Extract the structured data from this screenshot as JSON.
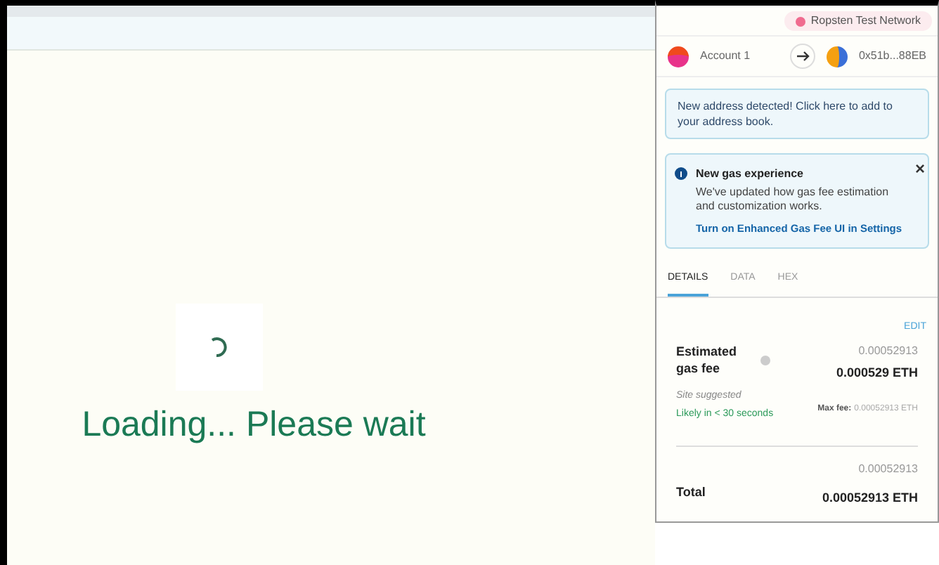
{
  "page": {
    "loading_text": "Loading... Please wait"
  },
  "wallet": {
    "network": "Ropsten Test Network",
    "from_account": "Account 1",
    "to_address": "0x51b...88EB",
    "address_notice": "New address detected! Click here to add to your address book.",
    "gas_notice": {
      "title": "New gas experience",
      "body": "We've updated how gas fee estimation and customization works.",
      "link": "Turn on Enhanced Gas Fee UI in Settings",
      "close": "×"
    },
    "tabs": [
      {
        "label": "DETAILS",
        "selected": true
      },
      {
        "label": "DATA",
        "selected": false
      },
      {
        "label": "HEX",
        "selected": false
      }
    ],
    "edit": "EDIT",
    "estimated_gas_fee": {
      "label": "Estimated gas fee",
      "amount": "0.00052913",
      "amount_eth": "0.000529 ETH",
      "site_suggested": "Site suggested",
      "timing": "Likely in < 30 seconds",
      "max_fee_label": "Max fee:",
      "max_fee_value": "0.00052913 ETH"
    },
    "total": {
      "label": "Total",
      "amount": "0.00052913",
      "amount_eth": "0.00052913 ETH"
    }
  }
}
